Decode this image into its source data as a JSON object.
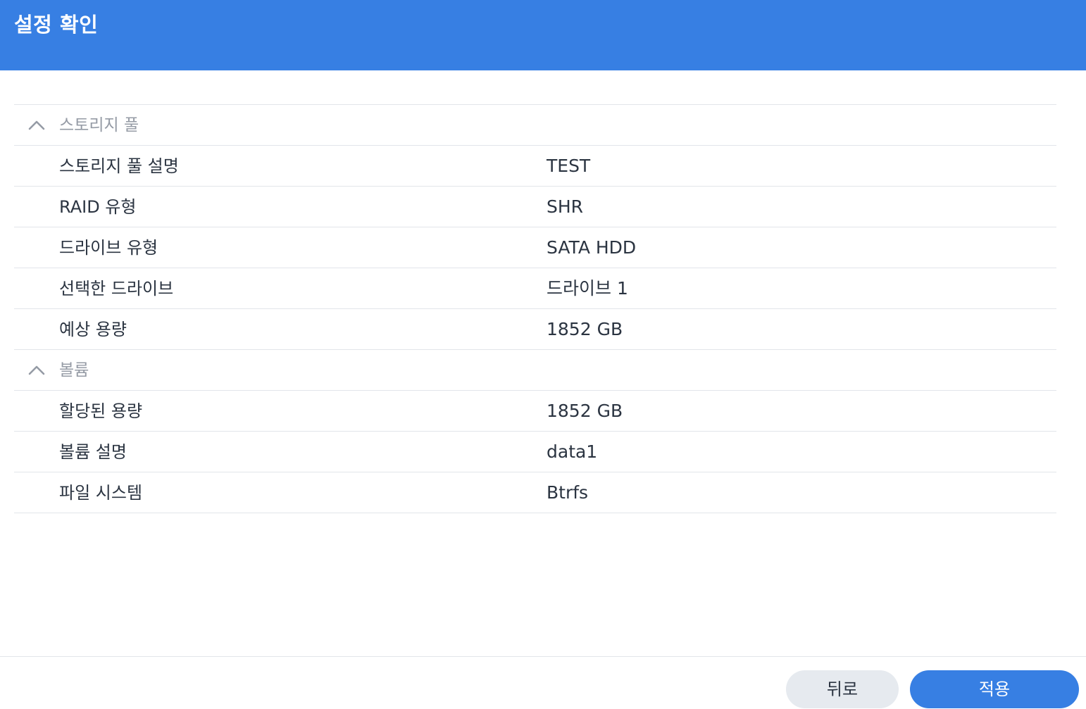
{
  "header": {
    "title": "설정 확인"
  },
  "groups": [
    {
      "label": "스토리지 풀",
      "items": [
        {
          "label": "스토리지 풀 설명",
          "value": "TEST"
        },
        {
          "label": "RAID 유형",
          "value": "SHR"
        },
        {
          "label": "드라이브 유형",
          "value": "SATA HDD"
        },
        {
          "label": "선택한 드라이브",
          "value": "드라이브 1"
        },
        {
          "label": "예상 용량",
          "value": "1852 GB"
        }
      ]
    },
    {
      "label": "볼륨",
      "items": [
        {
          "label": "할당된 용량",
          "value": "1852 GB"
        },
        {
          "label": "볼륨 설명",
          "value": "data1"
        },
        {
          "label": "파일 시스템",
          "value": "Btrfs"
        }
      ]
    }
  ],
  "footer": {
    "back_label": "뒤로",
    "apply_label": "적용"
  },
  "colors": {
    "accent": "#377fe3",
    "text": "#2b3441",
    "muted": "#959ba5",
    "divider": "#e2e5ea"
  }
}
